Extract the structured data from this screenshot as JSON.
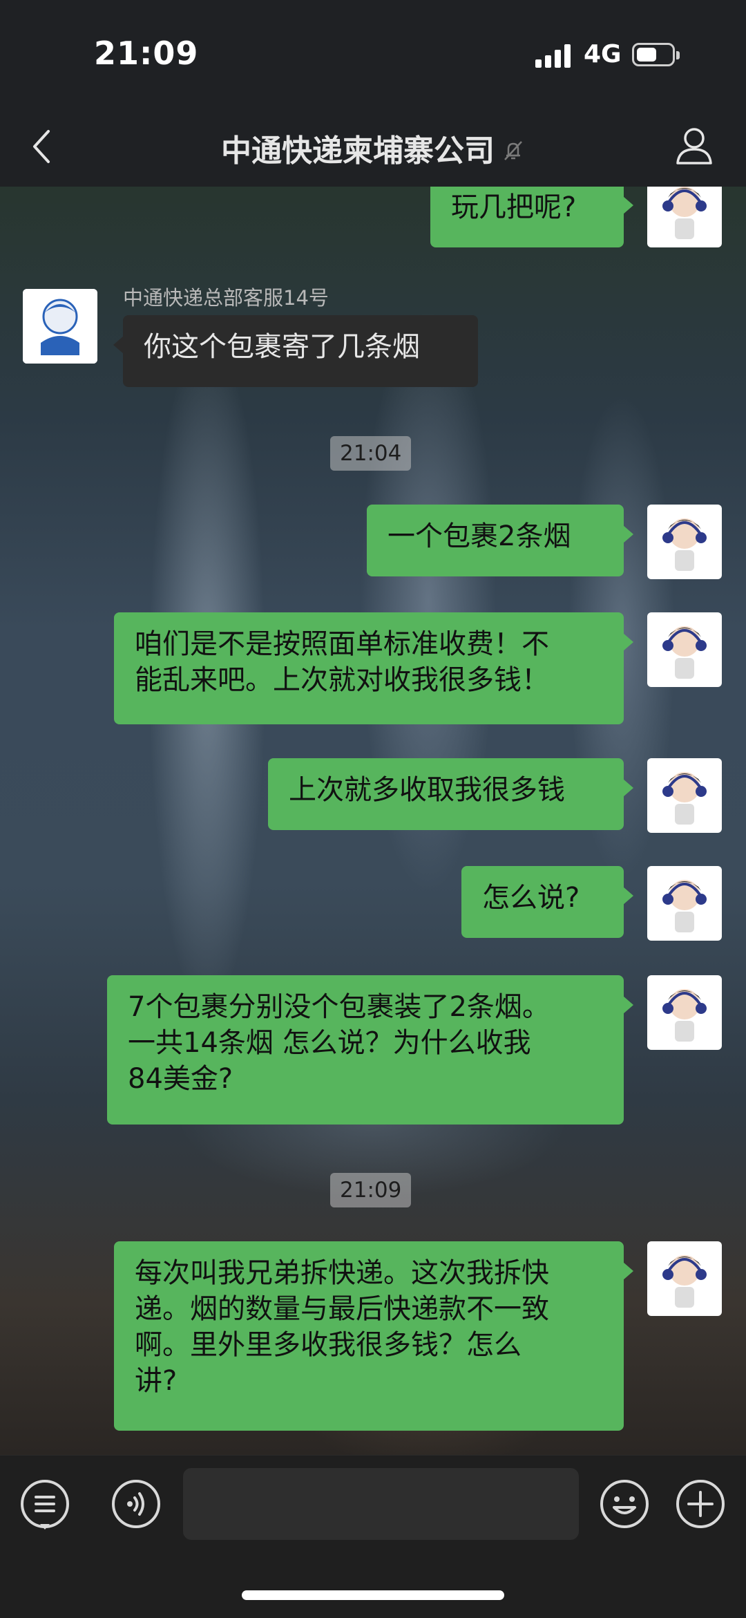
{
  "status_bar": {
    "time": "21:09",
    "network": "4G"
  },
  "nav": {
    "title": "中通快递柬埔寨公司"
  },
  "messages": [
    {
      "side": "out",
      "text": "玩几把呢?"
    },
    {
      "side": "in",
      "sender": "中通快递总部客服14号",
      "text": "你这个包裹寄了几条烟"
    },
    {
      "type": "time",
      "text": "21:04"
    },
    {
      "side": "out",
      "text": "一个包裹2条烟"
    },
    {
      "side": "out",
      "lines": [
        "咱们是不是按照面单标准收费！不",
        "能乱来吧。上次就对收我很多钱！"
      ]
    },
    {
      "side": "out",
      "text": "上次就多收取我很多钱"
    },
    {
      "side": "out",
      "text": "怎么说?"
    },
    {
      "side": "out",
      "lines": [
        "7个包裹分别没个包裹装了2条烟。",
        "一共14条烟 怎么说？为什么收我",
        "84美金?"
      ]
    },
    {
      "type": "time",
      "text": "21:09"
    },
    {
      "side": "out",
      "lines": [
        "每次叫我兄弟拆快递。这次我拆快",
        "递。烟的数量与最后快递款不一致",
        "啊。里外里多收我很多钱？怎么",
        "讲?"
      ]
    }
  ]
}
